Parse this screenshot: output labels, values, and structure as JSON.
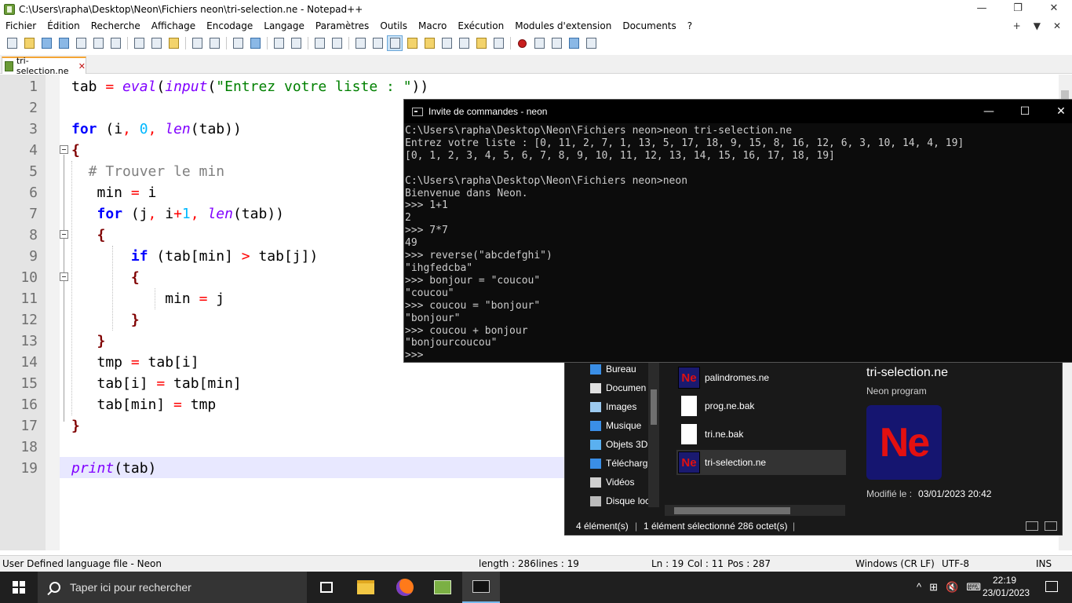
{
  "notepad": {
    "title": "C:\\Users\\rapha\\Desktop\\Neon\\Fichiers neon\\tri-selection.ne - Notepad++",
    "window_controls": [
      "—",
      "❐",
      "✕"
    ],
    "menu": [
      "Fichier",
      "Édition",
      "Recherche",
      "Affichage",
      "Encodage",
      "Langage",
      "Paramètres",
      "Outils",
      "Macro",
      "Exécution",
      "Modules d'extension",
      "Documents",
      "?"
    ],
    "menu_right": [
      "+",
      "▼",
      "✕"
    ],
    "tab": {
      "label": "tri-selection.ne",
      "close": "✕"
    },
    "line_numbers": [
      "1",
      "2",
      "3",
      "4",
      "5",
      "6",
      "7",
      "8",
      "9",
      "10",
      "11",
      "12",
      "13",
      "14",
      "15",
      "16",
      "17",
      "18",
      "19"
    ],
    "code_lines": [
      "tab = eval(input(\"Entrez votre liste : \"))",
      "",
      "for (i, 0, len(tab))",
      "{",
      "  # Trouver le min",
      "   min = i",
      "   for (j, i+1, len(tab))",
      "   {",
      "       if (tab[min] > tab[j])",
      "       {",
      "           min = j",
      "       }",
      "   }",
      "   tmp = tab[i]",
      "   tab[i] = tab[min]",
      "   tab[min] = tmp",
      "}",
      "",
      "print(tab)"
    ],
    "status": {
      "language": "User Defined language file - Neon",
      "length": "length : 286",
      "lines": "lines : 19",
      "ln": "Ln : 19",
      "col": "Col : 11",
      "pos": "Pos : 287",
      "eol": "Windows (CR LF)",
      "encoding": "UTF-8",
      "mode": "INS"
    }
  },
  "console": {
    "title": "Invite de commandes - neon",
    "controls": [
      "—",
      "☐",
      "✕"
    ],
    "lines": [
      "C:\\Users\\rapha\\Desktop\\Neon\\Fichiers neon>neon tri-selection.ne",
      "Entrez votre liste : [0, 11, 2, 7, 1, 13, 5, 17, 18, 9, 15, 8, 16, 12, 6, 3, 10, 14, 4, 19]",
      "[0, 1, 2, 3, 4, 5, 6, 7, 8, 9, 10, 11, 12, 13, 14, 15, 16, 17, 18, 19]",
      "",
      "C:\\Users\\rapha\\Desktop\\Neon\\Fichiers neon>neon",
      "Bienvenue dans Neon.",
      ">>> 1+1",
      "2",
      ">>> 7*7",
      "49",
      ">>> reverse(\"abcdefghi\")",
      "\"ihgfedcba\"",
      ">>> bonjour = \"coucou\"",
      "\"coucou\"",
      ">>> coucou = \"bonjour\"",
      "\"bonjour\"",
      ">>> coucou + bonjour",
      "\"bonjourcoucou\"",
      ">>>"
    ]
  },
  "explorer": {
    "nav": [
      {
        "label": "Bureau",
        "icon": "desktop-icon",
        "color": "#3a8ee6"
      },
      {
        "label": "Documen",
        "icon": "documents-icon",
        "color": "#e0e0e0"
      },
      {
        "label": "Images",
        "icon": "images-icon",
        "color": "#9ccaf0"
      },
      {
        "label": "Musique",
        "icon": "music-icon",
        "color": "#3a8ee6"
      },
      {
        "label": "Objets 3D",
        "icon": "objects3d-icon",
        "color": "#5ab0f0"
      },
      {
        "label": "Télécharg",
        "icon": "download-icon",
        "color": "#3a8ee6"
      },
      {
        "label": "Vidéos",
        "icon": "videos-icon",
        "color": "#d0d0d0"
      },
      {
        "label": "Disque loc",
        "icon": "disk-icon",
        "color": "#bbbbbb"
      }
    ],
    "files": [
      {
        "name": "palindromes.ne",
        "type": "ne"
      },
      {
        "name": "prog.ne.bak",
        "type": "doc"
      },
      {
        "name": "tri.ne.bak",
        "type": "doc"
      },
      {
        "name": "tri-selection.ne",
        "type": "ne",
        "selected": true
      }
    ],
    "file_icon_text": "Ne",
    "preview": {
      "title": "tri-selection.ne",
      "subtitle": "Neon program",
      "logo_text": "Ne",
      "modified_label": "Modifié le :",
      "modified_value": "03/01/2023 20:42"
    },
    "status": {
      "count": "4 élément(s)",
      "selection": "1 élément sélectionné  286 octet(s)"
    }
  },
  "taskbar": {
    "search_placeholder": "Taper ici pour rechercher",
    "time": "22:19",
    "date": "23/01/2023",
    "tray_icons": [
      "^",
      "⊞",
      "🔇",
      "⌨"
    ]
  }
}
